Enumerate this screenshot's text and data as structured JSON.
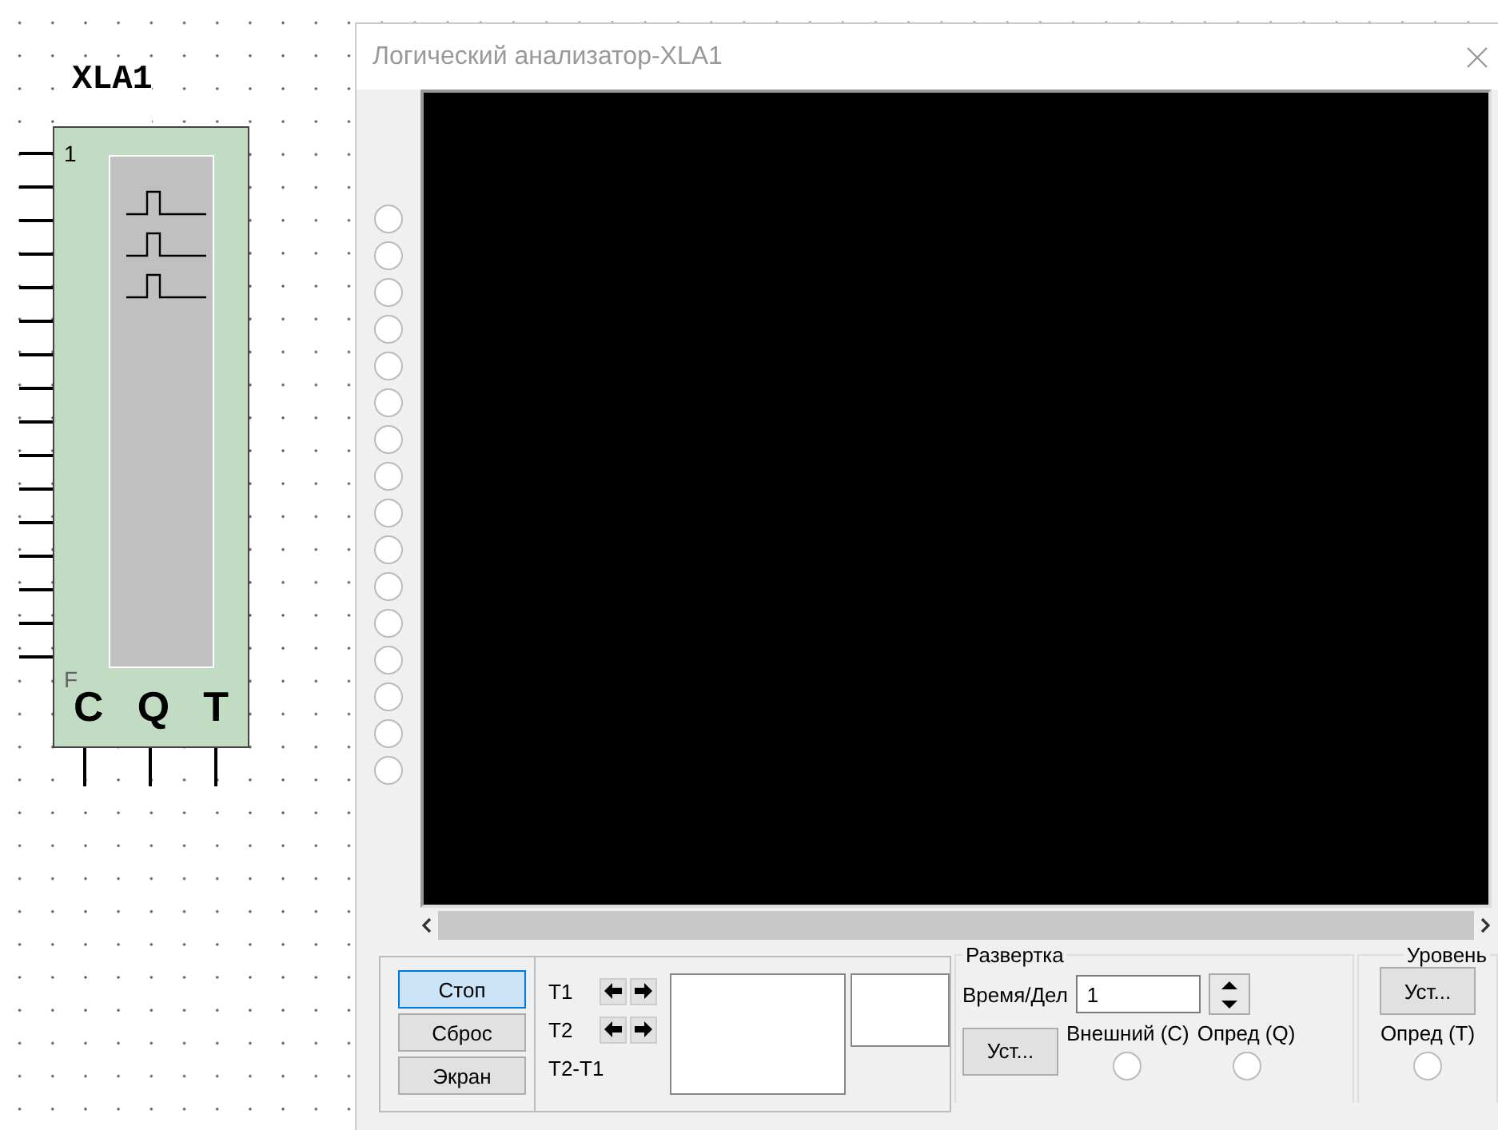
{
  "component": {
    "label": "XLA1",
    "first_pin": "1",
    "last_pin": "F",
    "bottom_pins": [
      "C",
      "Q",
      "T"
    ]
  },
  "window": {
    "title": "Логический анализатор-XLA1"
  },
  "controls": [
    {
      "label": "Стоп",
      "selected": true
    },
    {
      "label": "Сброс",
      "selected": false
    },
    {
      "label": "Экран",
      "selected": false
    }
  ],
  "cursors": [
    {
      "label": "T1",
      "kind": "arrows"
    },
    {
      "label": "T2",
      "kind": "arrows"
    },
    {
      "label": "T2-T1",
      "kind": "plain"
    }
  ],
  "sweep": {
    "title": "Развертка",
    "time_label": "Время/Дел",
    "time_value": "1",
    "set_button": "Уст...",
    "options": [
      {
        "label": "Внешний (C)",
        "selected": false
      },
      {
        "label": "Опред (Q)",
        "selected": false
      }
    ]
  },
  "level": {
    "title": "Уровень",
    "set_button": "Уст...",
    "options": [
      {
        "label": "Опред (T)",
        "selected": false
      }
    ]
  }
}
